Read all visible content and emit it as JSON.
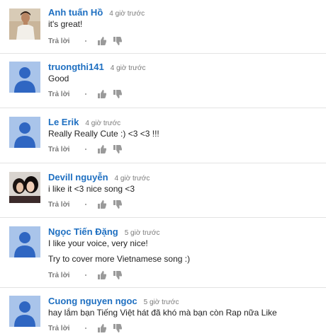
{
  "comments": [
    {
      "author": "Anh tuấn Hồ",
      "time": "4 giờ trước",
      "lines": [
        "it's great!"
      ],
      "reply_label": "Trả lời",
      "avatar": "photo-person"
    },
    {
      "author": "truongthi141",
      "time": "4 giờ trước",
      "lines": [
        "Good"
      ],
      "reply_label": "Trả lời",
      "avatar": "default-user"
    },
    {
      "author": "Le Erik",
      "time": "4 giờ trước",
      "lines": [
        "Really Really Cute :) <3 <3 !!!"
      ],
      "reply_label": "Trả lời",
      "avatar": "default-user"
    },
    {
      "author": "Devill nguyễn",
      "time": "4 giờ trước",
      "lines": [
        "i like it <3 nice song <3"
      ],
      "reply_label": "Trả lời",
      "avatar": "photo-couple"
    },
    {
      "author": "Ngọc Tiến Đặng",
      "time": "5 giờ trước",
      "lines": [
        "I like your voice, very nice!",
        "Try to cover more Vietnamese song :)"
      ],
      "reply_label": "Trả lời",
      "avatar": "default-user"
    },
    {
      "author": "Cuong nguyen ngoc",
      "time": "5 giờ trước",
      "lines": [
        "hay lắm bạn Tiếng Việt hát đã khó mà bạn còn Rap nữa Like"
      ],
      "reply_label": "Trả lời",
      "avatar": "default-user"
    }
  ],
  "colors": {
    "author": "#1e6fc1",
    "avatar_bg": "#a9c4ea",
    "avatar_figure": "#2f66c2",
    "divider": "#e3e3e3"
  }
}
